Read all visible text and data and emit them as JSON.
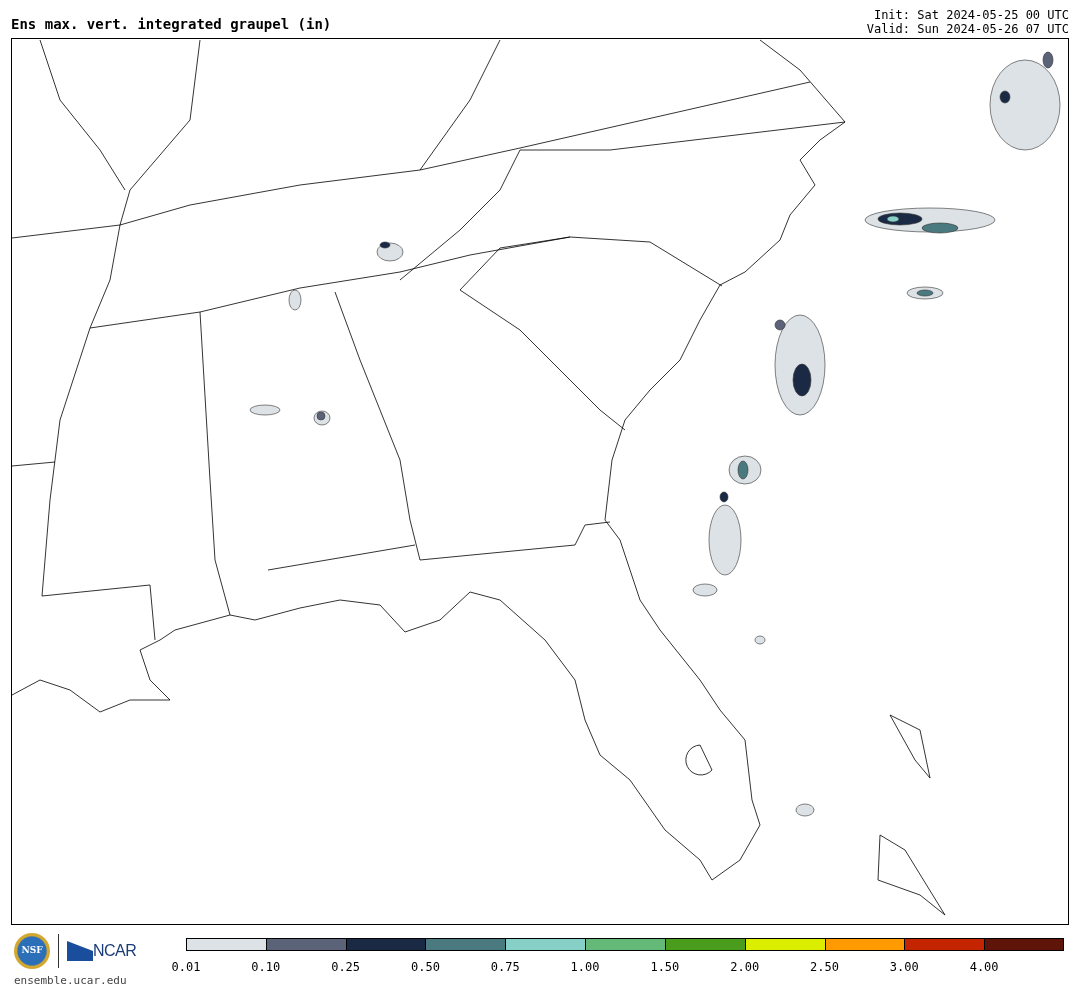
{
  "header": {
    "title": "Ens max. vert. integrated graupel (in)",
    "init": "Init: Sat 2024-05-25 00 UTC",
    "valid": "Valid: Sun 2024-05-26 07 UTC"
  },
  "footer": {
    "nsf_logo": "NSF",
    "ncar_logo": "NCAR",
    "website": "ensemble.ucar.edu"
  },
  "colorbar": {
    "segments": [
      {
        "label": "0.01",
        "color": "#dde2e6"
      },
      {
        "label": "0.10",
        "color": "#5a6378"
      },
      {
        "label": "0.25",
        "color": "#1a2a44"
      },
      {
        "label": "0.50",
        "color": "#4a7a80"
      },
      {
        "label": "0.75",
        "color": "#86d0c8"
      },
      {
        "label": "1.00",
        "color": "#64b878"
      },
      {
        "label": "1.50",
        "color": "#4a9c1c"
      },
      {
        "label": "2.00",
        "color": "#dcee00"
      },
      {
        "label": "2.50",
        "color": "#ff9a00"
      },
      {
        "label": "3.00",
        "color": "#c42400"
      },
      {
        "label": "4.00",
        "color": "#5e1408"
      }
    ]
  }
}
